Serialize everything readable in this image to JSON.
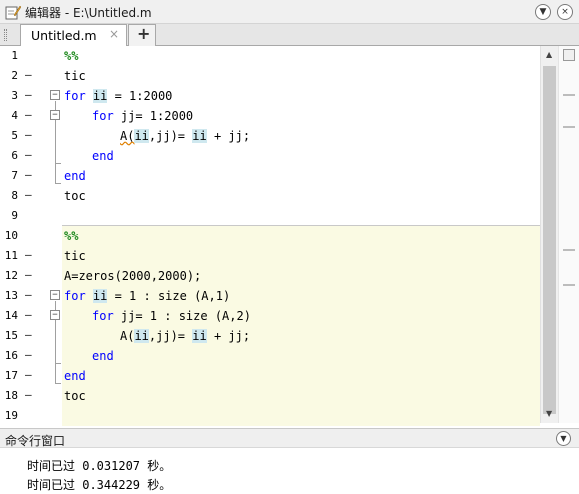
{
  "window": {
    "title": "编辑器 - E:\\Untitled.m",
    "btn_menu": "▼",
    "btn_close": "×"
  },
  "tabs": {
    "active_label": "Untitled.m",
    "close_glyph": "×",
    "add_glyph": "+"
  },
  "editor": {
    "line_numbers": [
      "1",
      "2",
      "3",
      "4",
      "5",
      "6",
      "7",
      "8",
      "9",
      "10",
      "11",
      "12",
      "13",
      "14",
      "15",
      "16",
      "17",
      "18",
      "19"
    ],
    "dash_glyph": "–",
    "fold_glyph": "−",
    "lines": {
      "l1": "%%",
      "l2": "tic",
      "l3_kw": "for",
      "l3_var": "ii",
      "l3_rest": " = 1:2000",
      "l4_kw": "for",
      "l4_rest": " jj= 1:2000",
      "l5_pre": "A(",
      "l5_var1": "ii",
      "l5_mid": ",jj)= ",
      "l5_var2": "ii",
      "l5_rest": " + jj;",
      "l6": "end",
      "l7": "end",
      "l8": "toc",
      "l10": "%%",
      "l11": "tic",
      "l12": "A=zeros(2000,2000);",
      "l13_kw": "for",
      "l13_var": "ii",
      "l13_rest": " = 1 : size (A,1)",
      "l14_kw": "for",
      "l14_rest": " jj= 1 : size (A,2)",
      "l15_pre": "A(",
      "l15_var1": "ii",
      "l15_mid": ",jj)= ",
      "l15_var2": "ii",
      "l15_rest": " + jj;",
      "l16": "end",
      "l17": "end",
      "l18": "toc"
    }
  },
  "scrollbar": {
    "up": "▲",
    "down": "▼"
  },
  "command_window": {
    "title": "命令行窗口",
    "menu_glyph": "▼",
    "output": [
      "时间已过 0.031207 秒。",
      "时间已过 0.344229 秒。"
    ]
  }
}
